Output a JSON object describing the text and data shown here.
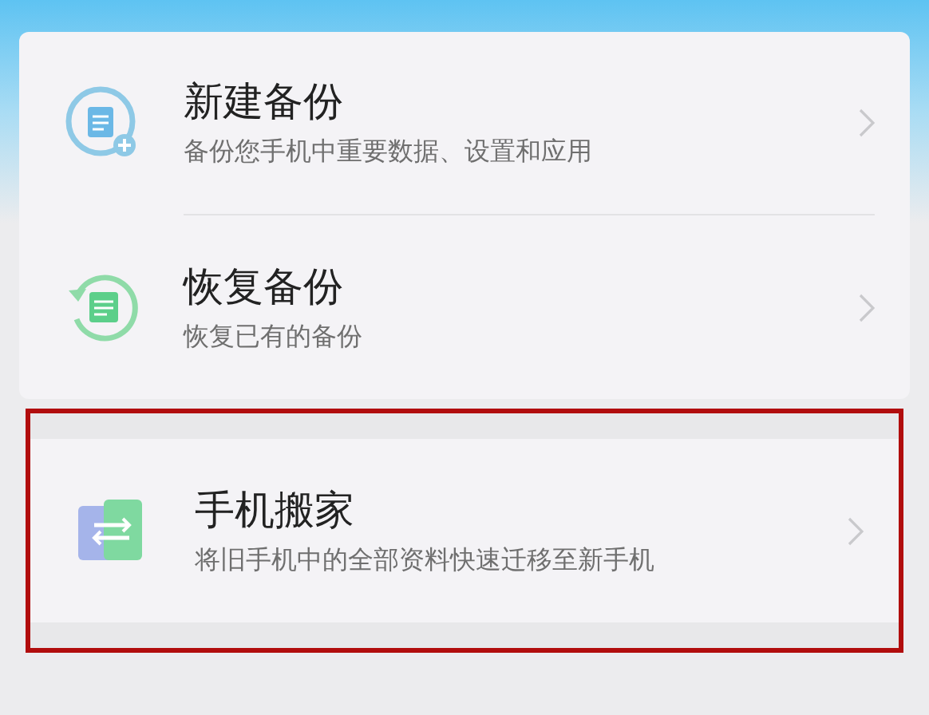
{
  "items": [
    {
      "kind": "new-backup",
      "title": "新建备份",
      "subtitle": "备份您手机中重要数据、设置和应用",
      "highlighted": false
    },
    {
      "kind": "restore",
      "title": "恢复备份",
      "subtitle": "恢复已有的备份",
      "highlighted": false
    },
    {
      "kind": "phone-clone",
      "title": "手机搬家",
      "subtitle": "将旧手机中的全部资料快速迁移至新手机",
      "highlighted": true
    }
  ]
}
